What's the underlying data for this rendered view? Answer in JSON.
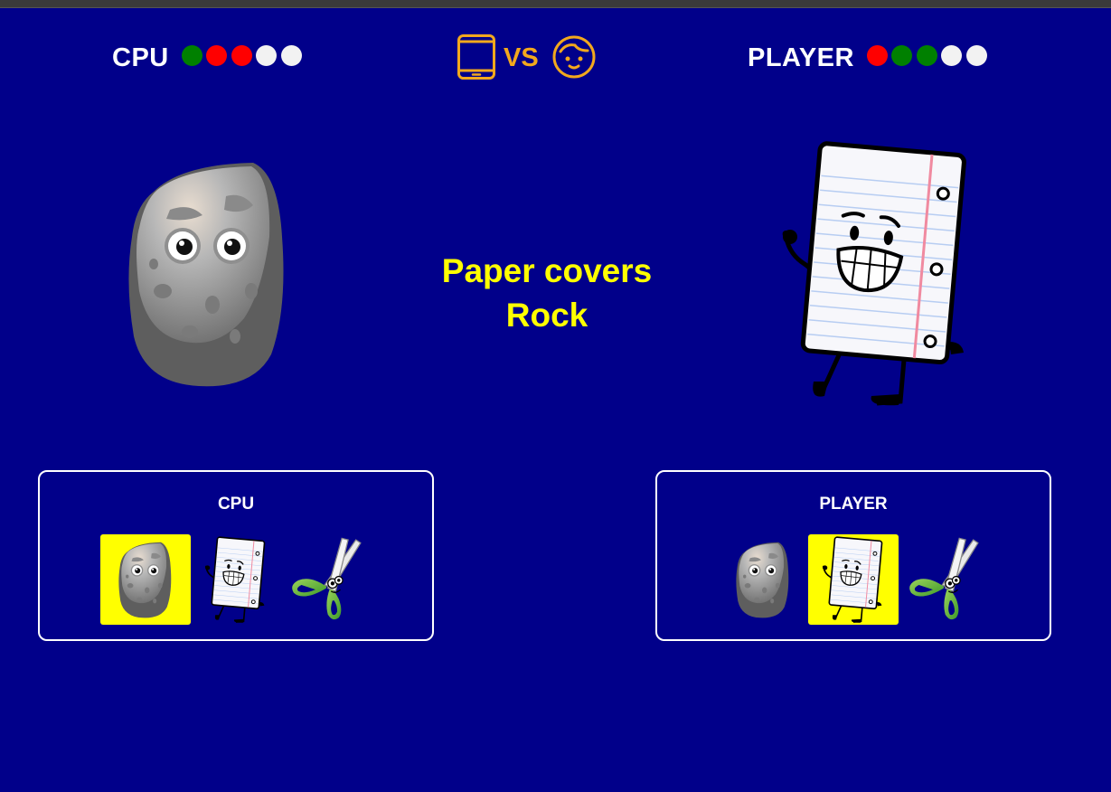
{
  "scoreboard": {
    "cpu": {
      "label": "CPU",
      "rounds": [
        "win",
        "loss",
        "loss",
        "pending",
        "pending"
      ]
    },
    "player": {
      "label": "PLAYER",
      "rounds": [
        "loss",
        "win",
        "win",
        "pending",
        "pending"
      ]
    },
    "vs_label": "VS",
    "cpu_icon": "tablet-icon",
    "player_icon": "face-icon"
  },
  "round_colors": {
    "win": "#008000",
    "loss": "#ff0000",
    "pending": "#f2f2f2"
  },
  "accent_color": "#f2a81d",
  "result_color": "#ffff00",
  "background_color": "#01008a",
  "arena": {
    "cpu_choice": "rock",
    "player_choice": "paper",
    "result_line1": "Paper covers",
    "result_line2": "Rock"
  },
  "panels": {
    "cpu": {
      "title": "CPU",
      "selected": "rock"
    },
    "player": {
      "title": "PLAYER",
      "selected": "paper"
    }
  },
  "choices": [
    "rock",
    "paper",
    "scissors"
  ]
}
